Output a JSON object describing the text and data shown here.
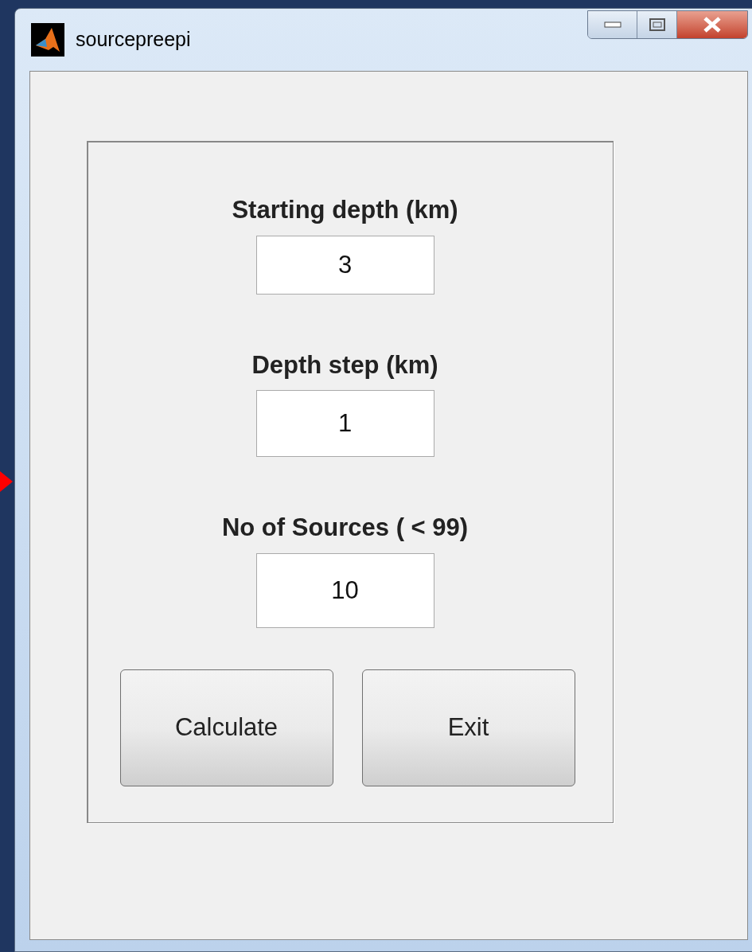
{
  "window": {
    "title": "sourcepreepi"
  },
  "fields": [
    {
      "label": "Starting depth (km)",
      "value": "3"
    },
    {
      "label": "Depth step (km)",
      "value": "1"
    },
    {
      "label": "No of Sources ( < 99)",
      "value": "10"
    }
  ],
  "buttons": [
    "Calculate",
    "Exit"
  ]
}
